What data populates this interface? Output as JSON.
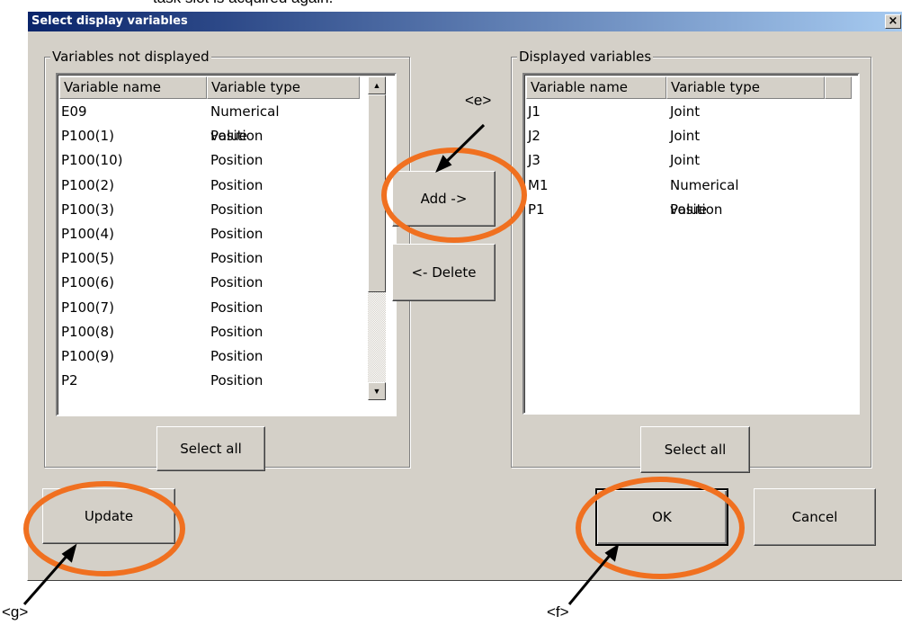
{
  "cutoff_text": "task slot is acquired again.",
  "dialog": {
    "title": "Select display variables",
    "close_label": "×"
  },
  "left_panel": {
    "legend": "Variables not displayed",
    "col_name": "Variable name",
    "col_type": "Variable type",
    "rows": [
      {
        "name": "E09",
        "type": "Numerical value"
      },
      {
        "name": "P100(1)",
        "type": "Position"
      },
      {
        "name": "P100(10)",
        "type": "Position"
      },
      {
        "name": "P100(2)",
        "type": "Position"
      },
      {
        "name": "P100(3)",
        "type": "Position"
      },
      {
        "name": "P100(4)",
        "type": "Position"
      },
      {
        "name": "P100(5)",
        "type": "Position"
      },
      {
        "name": "P100(6)",
        "type": "Position"
      },
      {
        "name": "P100(7)",
        "type": "Position"
      },
      {
        "name": "P100(8)",
        "type": "Position"
      },
      {
        "name": "P100(9)",
        "type": "Position"
      },
      {
        "name": "P2",
        "type": "Position"
      }
    ],
    "select_all": "Select all"
  },
  "right_panel": {
    "legend": "Displayed variables",
    "col_name": "Variable name",
    "col_type": "Variable type",
    "rows": [
      {
        "name": "J1",
        "type": "Joint"
      },
      {
        "name": "J2",
        "type": "Joint"
      },
      {
        "name": "J3",
        "type": "Joint"
      },
      {
        "name": "M1",
        "type": "Numerical value"
      },
      {
        "name": "P1",
        "type": "Position"
      }
    ],
    "select_all": "Select all"
  },
  "buttons": {
    "add": "Add ->",
    "delete": "<- Delete",
    "update": "Update",
    "ok": "OK",
    "cancel": "Cancel"
  },
  "annotations": {
    "e": "<e>",
    "f": "<f>",
    "g": "<g>",
    "highlight_color": "#f07020"
  }
}
